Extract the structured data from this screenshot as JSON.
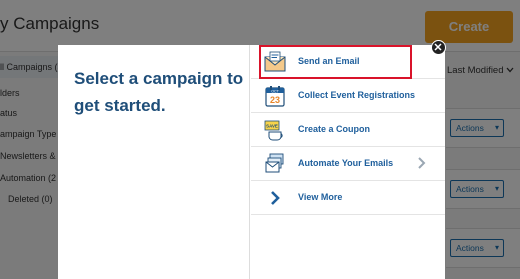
{
  "page": {
    "title": "y Campaigns",
    "create_label": "Create",
    "sort_label": "Last Modified",
    "sidebar": {
      "items": [
        {
          "label": "ll Campaigns (3"
        },
        {
          "label": "lders"
        },
        {
          "label": "atus"
        },
        {
          "label": "ampaign Type"
        },
        {
          "label": "Newsletters &"
        },
        {
          "label": "Automation (2"
        },
        {
          "label": "Deleted (0)"
        }
      ]
    },
    "rows": [
      {
        "actions_label": "Actions"
      },
      {
        "actions_label": "Actions"
      },
      {
        "actions_label": "Actions"
      }
    ]
  },
  "modal": {
    "heading": "Select a campaign to get started.",
    "options": [
      {
        "label": "Send an Email",
        "icon": "email-icon"
      },
      {
        "label": "Collect Event Registrations",
        "icon": "calendar-icon",
        "calendar_day": "23",
        "calendar_month": "OCT"
      },
      {
        "label": "Create a Coupon",
        "icon": "coupon-icon",
        "coupon_text": "SAVE"
      },
      {
        "label": "Automate Your Emails",
        "icon": "automation-icon",
        "has_chevron": true
      },
      {
        "label": "View More",
        "icon": "chevron-right-icon"
      }
    ]
  },
  "colors": {
    "brand_blue": "#1f5f9c",
    "heading_blue": "#1f4e79",
    "create_orange": "#f7a421",
    "highlight_red": "#d9132a"
  }
}
